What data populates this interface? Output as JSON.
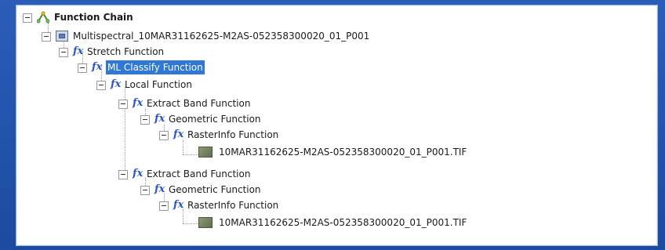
{
  "tree": {
    "root": {
      "label": "Function Chain",
      "icon": "function-chain-icon"
    },
    "items": [
      {
        "id": "multispectral",
        "label": "Multispectral_10MAR31162625-M2AS-052358300020_01_P001",
        "icon": "raster-dataset-icon"
      },
      {
        "id": "stretch",
        "label": "Stretch Function",
        "icon": "fx-icon"
      },
      {
        "id": "ml-classify",
        "label": "ML Classify Function",
        "icon": "fx-icon"
      },
      {
        "id": "local",
        "label": "Local Function",
        "icon": "fx-icon"
      },
      {
        "id": "extract-band-1",
        "label": "Extract Band Function",
        "icon": "fx-icon"
      },
      {
        "id": "geometric-1",
        "label": "Geometric Function",
        "icon": "fx-icon"
      },
      {
        "id": "rasterinfo-1",
        "label": "RasterInfo Function",
        "icon": "fx-icon"
      },
      {
        "id": "tif-1",
        "label": "10MAR31162625-M2AS-052358300020_01_P001.TIF",
        "icon": "tif-file-icon"
      },
      {
        "id": "extract-band-2",
        "label": "Extract Band Function",
        "icon": "fx-icon"
      },
      {
        "id": "geometric-2",
        "label": "Geometric Function",
        "icon": "fx-icon"
      },
      {
        "id": "rasterinfo-2",
        "label": "RasterInfo Function",
        "icon": "fx-icon"
      },
      {
        "id": "tif-2",
        "label": "10MAR31162625-M2AS-052358300020_01_P001.TIF",
        "icon": "tif-file-icon"
      }
    ]
  },
  "colors": {
    "background": "#1f4fa3",
    "selection": "#2f78d6",
    "fx_icon": "#2b56c8"
  }
}
